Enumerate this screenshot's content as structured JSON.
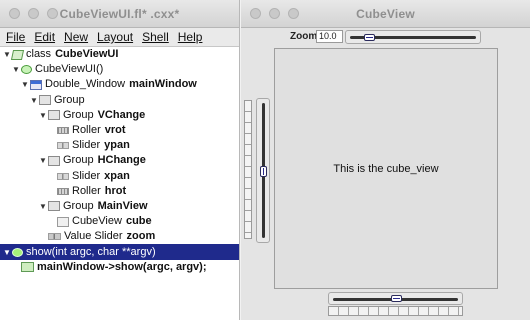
{
  "fluid": {
    "window_title": "CubeViewUI.fl* .cxx*",
    "menu": [
      "File",
      "Edit",
      "New",
      "Layout",
      "Shell",
      "Help"
    ],
    "tree": [
      {
        "indent": 0,
        "tri": "down",
        "icon": "class-icon",
        "type": "class",
        "name": "CubeViewUI"
      },
      {
        "indent": 1,
        "tri": "down",
        "icon": "function-icon",
        "type": "CubeViewUI()",
        "name": ""
      },
      {
        "indent": 2,
        "tri": "down",
        "icon": "window-icon",
        "type": "Double_Window",
        "name": "mainWindow"
      },
      {
        "indent": 3,
        "tri": "down",
        "icon": "group-icon",
        "type": "Group",
        "name": ""
      },
      {
        "indent": 4,
        "tri": "down",
        "icon": "group-icon",
        "type": "Group",
        "name": "VChange"
      },
      {
        "indent": 5,
        "tri": "",
        "icon": "roller-icon",
        "type": "Roller",
        "name": "vrot"
      },
      {
        "indent": 5,
        "tri": "",
        "icon": "slider-icon",
        "type": "Slider",
        "name": "ypan"
      },
      {
        "indent": 4,
        "tri": "down",
        "icon": "group-icon",
        "type": "Group",
        "name": "HChange"
      },
      {
        "indent": 5,
        "tri": "",
        "icon": "slider-icon",
        "type": "Slider",
        "name": "xpan"
      },
      {
        "indent": 5,
        "tri": "",
        "icon": "roller-icon",
        "type": "Roller",
        "name": "hrot"
      },
      {
        "indent": 4,
        "tri": "down",
        "icon": "group-icon",
        "type": "Group",
        "name": "MainView"
      },
      {
        "indent": 5,
        "tri": "",
        "icon": "cube-icon",
        "type": "CubeView",
        "name": "cube"
      },
      {
        "indent": 4,
        "tri": "",
        "icon": "value-slider-icon",
        "type": "Value Slider",
        "name": "zoom"
      },
      {
        "indent": 0,
        "tri": "down",
        "icon": "function-icon",
        "type": "show(int argc, char **argv)",
        "name": "",
        "selected": true
      },
      {
        "indent": 1,
        "tri": "",
        "icon": "code-icon",
        "type": "",
        "name": "mainWindow->show(argc, argv);"
      }
    ]
  },
  "cubeview": {
    "window_title": "CubeView",
    "zoom_label": "Zoom",
    "zoom_value": "10.0",
    "zoom_level": 0.12,
    "ypan_level": 0.5,
    "xpan_level": 0.5,
    "cube_text": "This is the cube_view"
  }
}
